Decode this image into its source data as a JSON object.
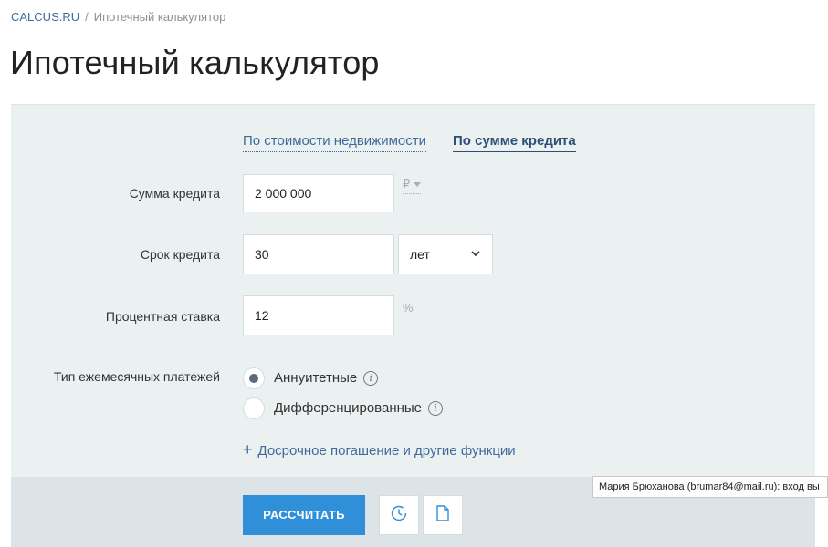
{
  "breadcrumb": {
    "home": "CALCUS.RU",
    "separator": "/",
    "current": "Ипотечный калькулятор"
  },
  "page_title": "Ипотечный калькулятор",
  "tabs": [
    {
      "label": "По стоимости недвижимости",
      "active": false
    },
    {
      "label": "По сумме кредита",
      "active": true
    }
  ],
  "form": {
    "loan_amount": {
      "label": "Сумма кредита",
      "value": "2 000 000",
      "unit": "₽"
    },
    "loan_term": {
      "label": "Срок кредита",
      "value": "30",
      "unit_selected": "лет"
    },
    "interest_rate": {
      "label": "Процентная ставка",
      "value": "12",
      "unit": "%"
    },
    "payment_type": {
      "label": "Тип ежемесячных платежей",
      "options": [
        {
          "label": "Аннуитетные",
          "checked": true
        },
        {
          "label": "Дифференцированные",
          "checked": false
        }
      ]
    },
    "extras_link": "Досрочное погашение и другие функции"
  },
  "actions": {
    "calculate_label": "РАССЧИТАТЬ"
  },
  "tooltip": "Мария Брюханова (brumar84@mail.ru): вход вы",
  "colors": {
    "accent": "#2f8fd8",
    "link": "#3f6b9a",
    "panel": "#ebf0f1"
  }
}
